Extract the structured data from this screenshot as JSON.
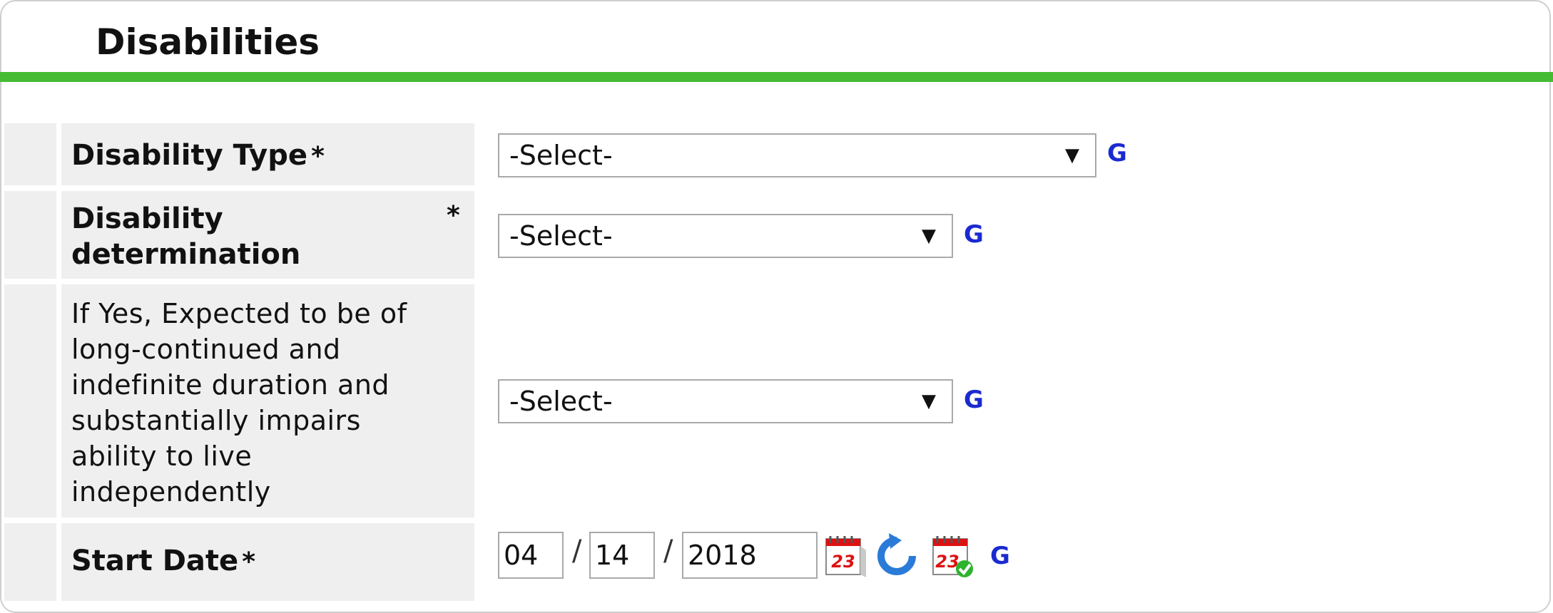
{
  "section": {
    "title": "Disabilities"
  },
  "fields": {
    "disability_type": {
      "label": "Disability Type",
      "required": "*",
      "value": "-Select-",
      "g": "G"
    },
    "disability_determination": {
      "label_line1": "Disability",
      "label_line2": "determination",
      "required": "*",
      "value": "-Select-",
      "g": "G"
    },
    "long_continued": {
      "label_lines": [
        "If Yes, Expected to be of",
        "long-continued and",
        "indefinite duration and",
        "substantially impairs",
        "ability to live",
        "independently"
      ],
      "value": "-Select-",
      "g": "G"
    },
    "start_date": {
      "label": "Start Date",
      "required": "*",
      "month": "04",
      "day": "14",
      "year": "2018",
      "sep": "/",
      "g": "G"
    }
  },
  "icons": {
    "calendar": "calendar-icon",
    "reset": "reset-icon",
    "calendar_confirm": "calendar-check-icon",
    "dropdown": "chevron-down-icon"
  },
  "colors": {
    "accent": "#44bb33",
    "g_link": "#1a2ad0",
    "label_bg": "#efefef"
  }
}
